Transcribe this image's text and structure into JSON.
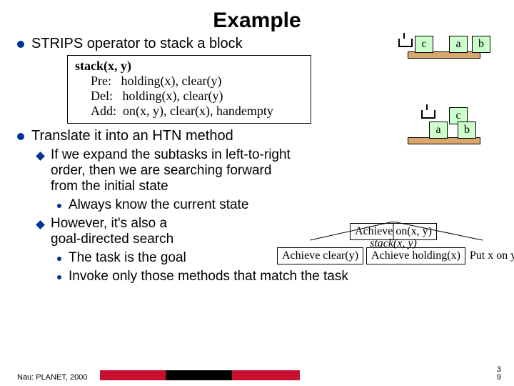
{
  "title": "Example",
  "bullets": {
    "top": "STRIPS operator to stack a block",
    "translate": "Translate it into an HTN method",
    "expand": "If we expand the subtasks in left-to-right order, then we are searching forward from the initial state",
    "always": "Always know the current state",
    "however": "However, it's also a goal-directed search",
    "task": "The task is the goal",
    "invoke": "Invoke only those methods that match the task"
  },
  "operator": {
    "name": "stack(x, y)",
    "pre_label": "Pre:",
    "pre_val": "holding(x), clear(y)",
    "del_label": "Del:",
    "del_val": "holding(x), clear(y)",
    "add_label": "Add:",
    "add_val": "on(x, y), clear(x), handempty"
  },
  "blocks": {
    "a": "a",
    "b": "b",
    "c": "c"
  },
  "tree": {
    "root": "Achieve on(x, y)",
    "mid": "stack(x, y)",
    "left": "Achieve clear(y)",
    "center": "Achieve holding(x)",
    "right": "Put x on y"
  },
  "footer": "Nau: PLANET, 2000",
  "page": {
    "top": "3",
    "bot": "9"
  }
}
